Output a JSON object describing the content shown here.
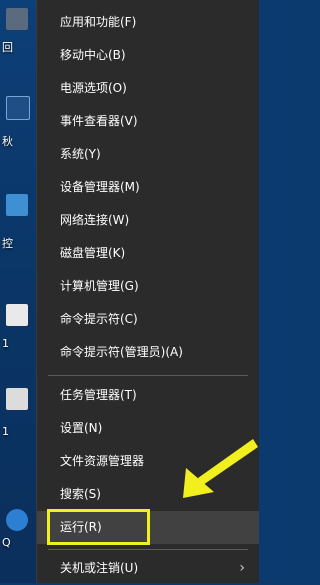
{
  "desktop": {
    "icons": [
      {
        "name": "desktop-icon-1",
        "label": "回"
      },
      {
        "name": "desktop-icon-2",
        "label": "秋"
      },
      {
        "name": "desktop-icon-3",
        "label": "控"
      },
      {
        "name": "desktop-icon-4",
        "label": "1"
      },
      {
        "name": "desktop-icon-5",
        "label": "1"
      },
      {
        "name": "desktop-icon-6",
        "label": "Q"
      }
    ]
  },
  "menu": {
    "items": [
      {
        "label": "应用和功能(F)"
      },
      {
        "label": "移动中心(B)"
      },
      {
        "label": "电源选项(O)"
      },
      {
        "label": "事件查看器(V)"
      },
      {
        "label": "系统(Y)"
      },
      {
        "label": "设备管理器(M)"
      },
      {
        "label": "网络连接(W)"
      },
      {
        "label": "磁盘管理(K)"
      },
      {
        "label": "计算机管理(G)"
      },
      {
        "label": "命令提示符(C)"
      },
      {
        "label": "命令提示符(管理员)(A)"
      },
      {
        "label": "任务管理器(T)"
      },
      {
        "label": "设置(N)"
      },
      {
        "label": "文件资源管理器"
      },
      {
        "label": "搜索(S)"
      },
      {
        "label": "运行(R)"
      },
      {
        "label": "关机或注销(U)"
      }
    ],
    "submenu_arrow": "›"
  },
  "annotation": {
    "highlight_color": "#f1ef1e",
    "arrow_color": "#f1ef1e"
  }
}
